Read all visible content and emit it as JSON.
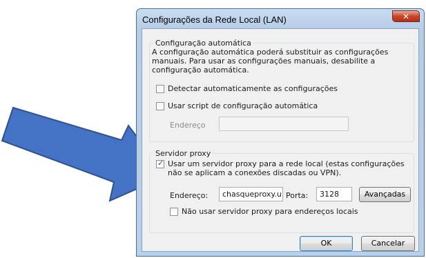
{
  "dialog": {
    "title": "Configurações da Rede Local (LAN)",
    "close_glyph": "✕"
  },
  "auto_config": {
    "legend": "Configuração automática",
    "description": "A configuração automática poderá substituir as configurações manuais. Para usar as configurações manuais, desabilite a configuração automática.",
    "detect_label": "Detectar automaticamente as configurações",
    "detect_checked": false,
    "script_label": "Usar script de configuração automática",
    "script_checked": false,
    "address_label": "Endereço",
    "address_value": ""
  },
  "proxy": {
    "legend": "Servidor proxy",
    "use_proxy_label": "Usar um servidor proxy para a rede local (estas configurações não se aplicam a conexões discadas ou VPN).",
    "use_proxy_checked": true,
    "address_label": "Endereço:",
    "address_value": "chasqueproxy.u",
    "port_label": "Porta:",
    "port_value": "3128",
    "advanced_label": "Avançadas",
    "bypass_local_label": "Não usar servidor proxy para endereços locais",
    "bypass_local_checked": false
  },
  "buttons": {
    "ok": "OK",
    "cancel": "Cancelar"
  },
  "colors": {
    "arrow_fill": "#4472c4",
    "arrow_stroke": "#2f528f",
    "title_bar": "#b9d0ea",
    "close_button": "#c9462c"
  }
}
